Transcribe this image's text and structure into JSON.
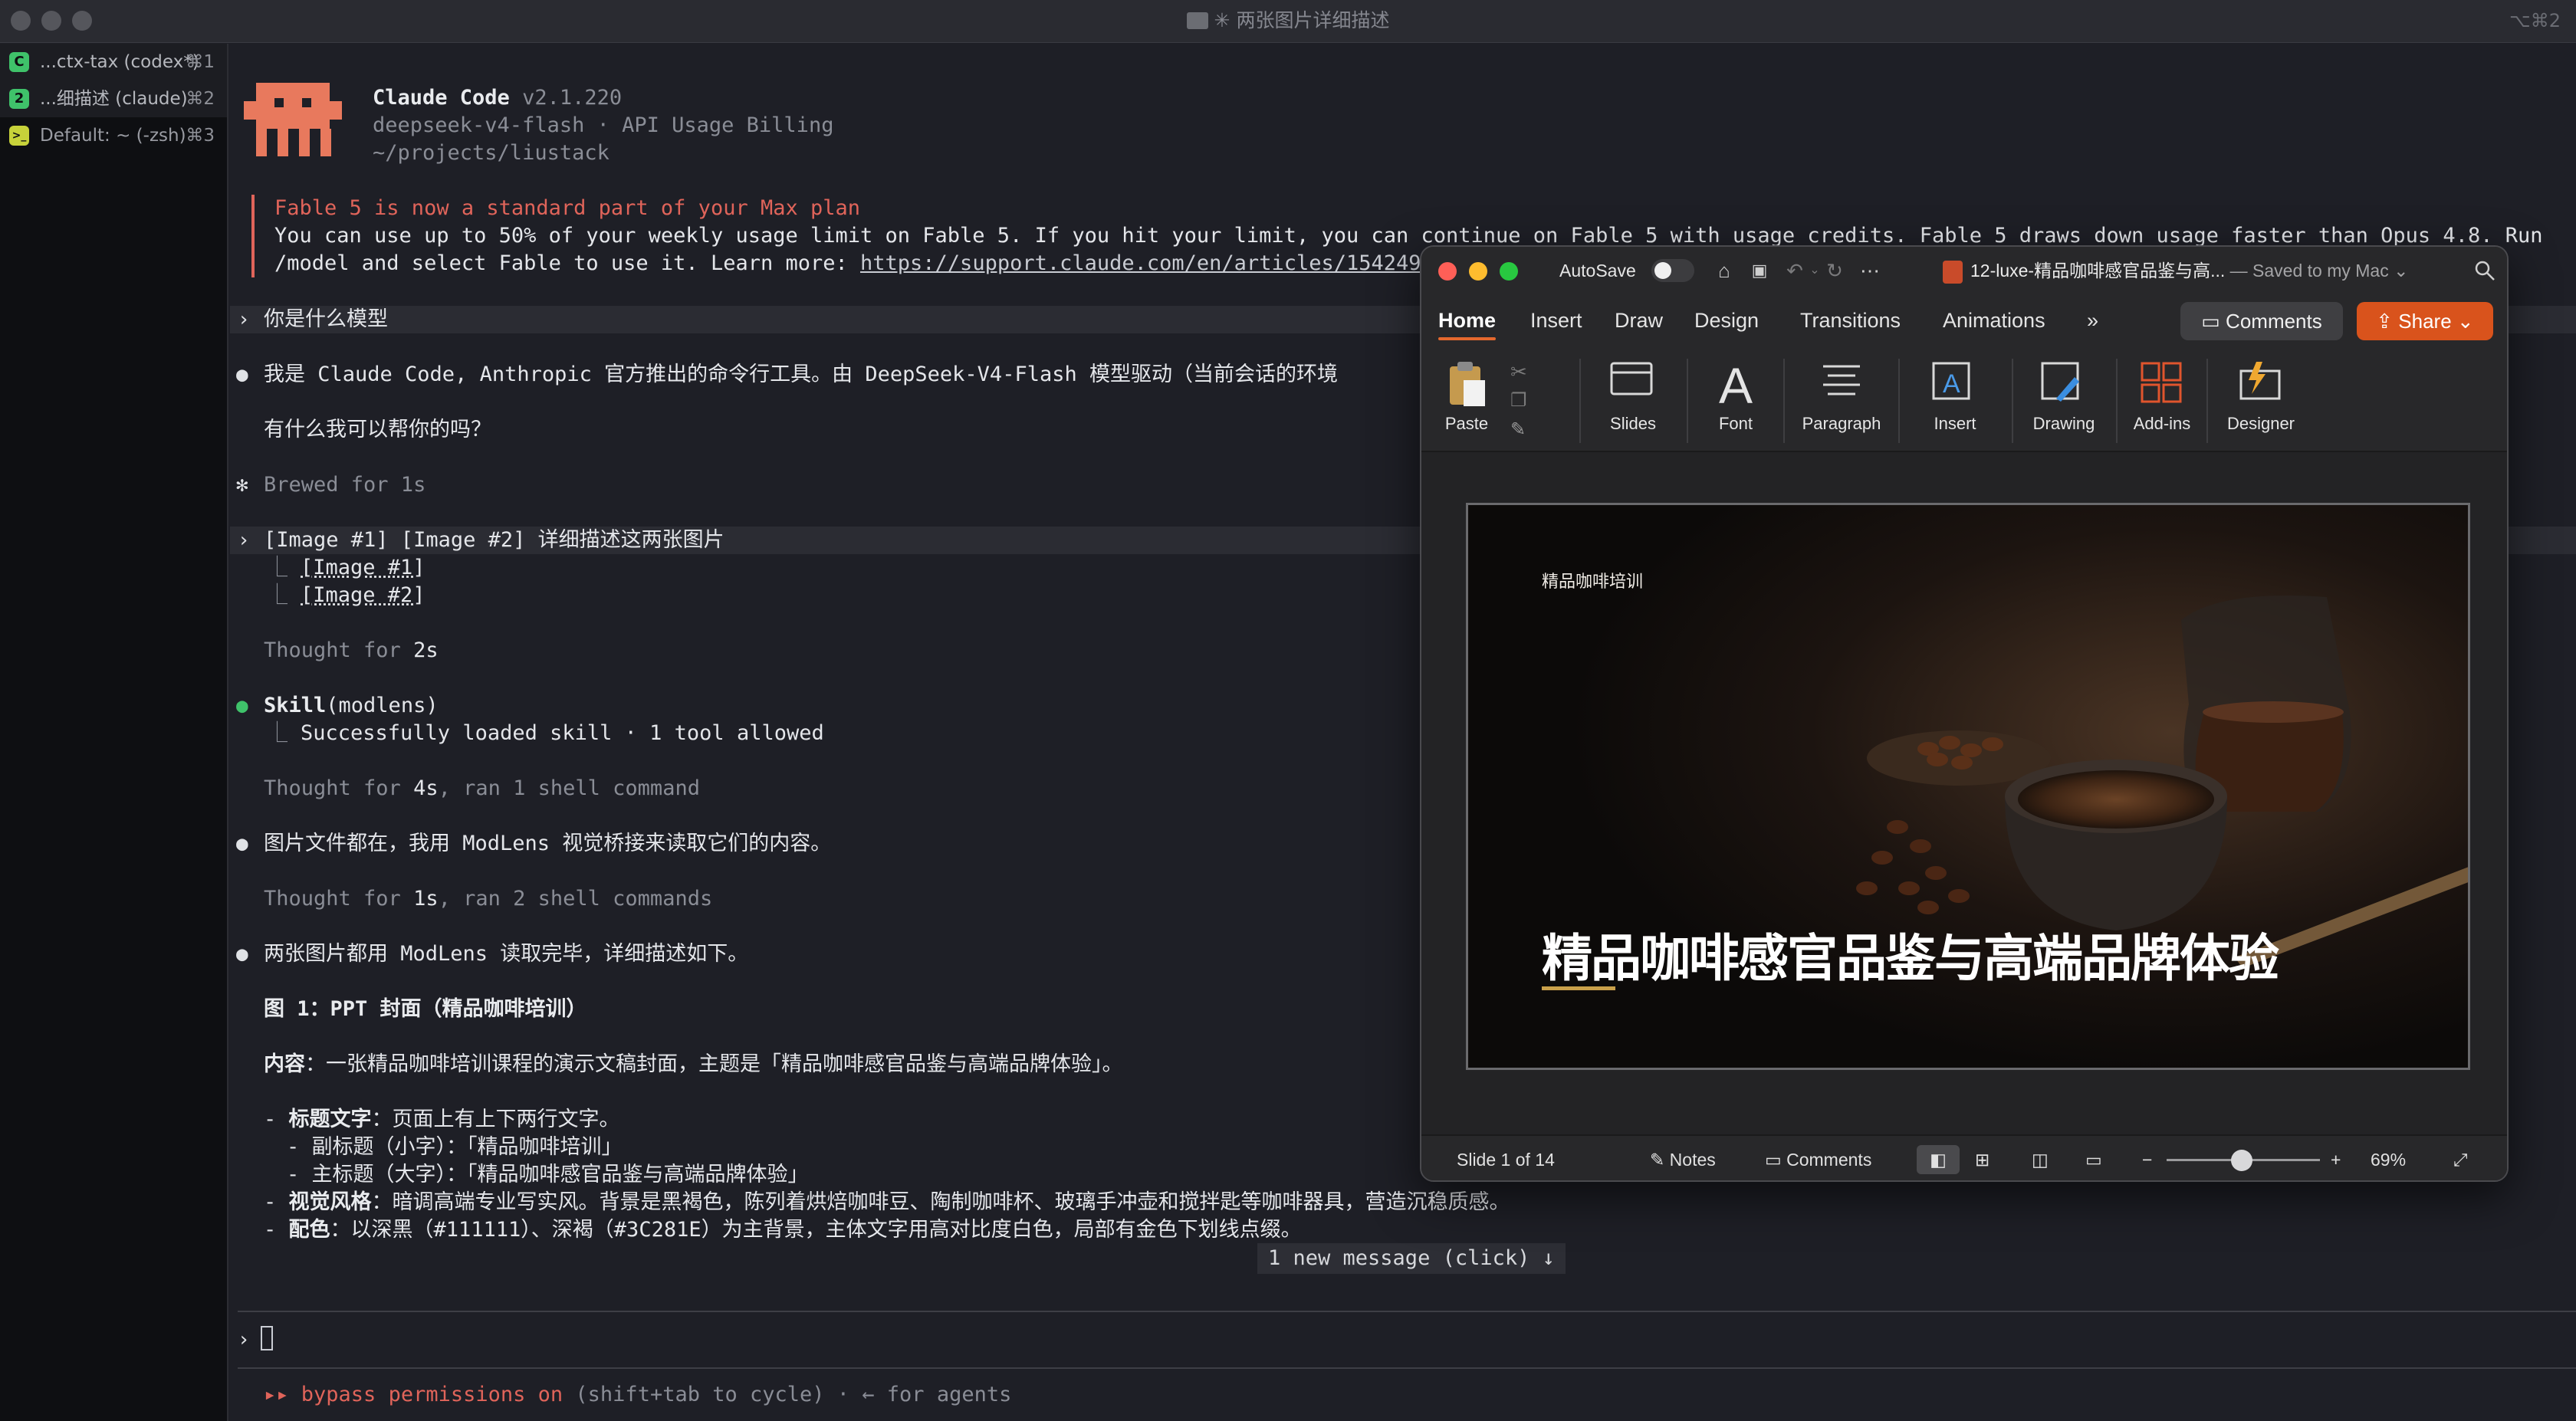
{
  "window": {
    "title": "✳ 两张图片详细描述",
    "shortcut": "⌥⌘2"
  },
  "sidebar": {
    "tabs": [
      {
        "badge": "C",
        "label": "...ctx-tax (codex*)",
        "shortcut": "⌘1",
        "color": "#3fc26a"
      },
      {
        "badge": "2",
        "label": "...细描述 (claude)",
        "shortcut": "⌘2",
        "color": "#3fc26a"
      },
      {
        "badge": ">_",
        "label": "Default: ~ (-zsh)",
        "shortcut": "⌘3",
        "color": "#c7d23a"
      }
    ]
  },
  "header": {
    "app_name": "Claude Code",
    "version": "v2.1.220",
    "model_line": "deepseek-v4-flash · API Usage Billing",
    "path": "~/projects/liustack"
  },
  "notice": {
    "title": "Fable 5 is now a standard part of your Max plan",
    "line1": "You can use up to 50% of your weekly usage limit on Fable 5. If you hit your limit, you can continue on Fable 5 with usage credits. Fable 5 draws down usage faster than Opus 4.8. Run",
    "line2_prefix": "/model and select Fable to use it. Learn more: ",
    "link": "https://support.claude.com/en/articles/15424964"
  },
  "conversation": {
    "q1": "你是什么模型",
    "a1": "我是 Claude Code, Anthropic 官方推出的命令行工具。由 DeepSeek-V4-Flash 模型驱动（当前会话的环境",
    "a1_follow": "有什么我可以帮你的吗？",
    "brewed": "Brewed for 1s",
    "q2": "[Image #1] [Image #2] 详细描述这两张图片",
    "q2_att1": "[Image #1]",
    "q2_att2": "[Image #2]",
    "thought1_prefix": "Thought for ",
    "thought1_val": "2s",
    "skill_name": "Skill",
    "skill_arg": "(modlens)",
    "skill_result": "Successfully loaded skill · 1 tool allowed",
    "thought2_prefix": "Thought for ",
    "thought2_val": "4s",
    "thought2_suffix": ", ran 1 shell command",
    "a2": "图片文件都在，我用 ModLens 视觉桥接来读取它们的内容。",
    "thought3_prefix": "Thought for ",
    "thought3_val": "1s",
    "thought3_suffix": ", ran 2 shell commands",
    "a3": "两张图片都用 ModLens 读取完毕，详细描述如下。",
    "fig_heading": "图 1：PPT 封面（精品咖啡培训）",
    "content_label": "内容",
    "content_text": "：一张精品咖啡培训课程的演示文稿封面，主题是「精品咖啡感官品鉴与高端品牌体验」。",
    "item1_label": "标题文字",
    "item1_text": "：页面上有上下两行文字。",
    "item1_sub1": "- 副标题（小字）：「精品咖啡培训」",
    "item1_sub2": "- 主标题（大字）：「精品咖啡感官品鉴与高端品牌体验」",
    "item2_label": "视觉风格",
    "item2_text": "：暗调高端专业写实风。背景是黑褐色，陈列着烘焙咖啡豆、陶制咖啡杯、玻璃手冲壶和搅拌匙等咖啡器具，营造沉稳质感。",
    "item3_label": "配色",
    "item3_text": "：以深黑（#111111）、深褐（#3C281E）为主背景，主体文字用高对比度白色，局部有金色下划线点缀。"
  },
  "new_message": "1 new message (click) ↓",
  "footer": {
    "mode_arrows": "▸▸",
    "mode_label": "bypass permissions on",
    "mode_hint": " (shift+tab to cycle) · ← for agents"
  },
  "ppt": {
    "autosave_label": "AutoSave",
    "doc_name": "12-luxe-精品咖啡感官品鉴与高...",
    "saved_status": " — Saved to my Mac ⌄",
    "tabs": [
      "Home",
      "Insert",
      "Draw",
      "Design",
      "Transitions",
      "Animations"
    ],
    "tabs_more": "»",
    "comments_label": "Comments",
    "share_label": "Share",
    "ribbon": {
      "paste": "Paste",
      "slides": "Slides",
      "font": "Font",
      "paragraph": "Paragraph",
      "insert": "Insert",
      "drawing": "Drawing",
      "addins": "Add-ins",
      "designer": "Designer"
    },
    "slide": {
      "subtitle": "精品咖啡培训",
      "title": "精品咖啡感官品鉴与高端品牌体验"
    },
    "status": {
      "slide_counter": "Slide 1 of 14",
      "notes": "Notes",
      "comments": "Comments",
      "zoom": "69%"
    },
    "accent": "#d9531c"
  }
}
